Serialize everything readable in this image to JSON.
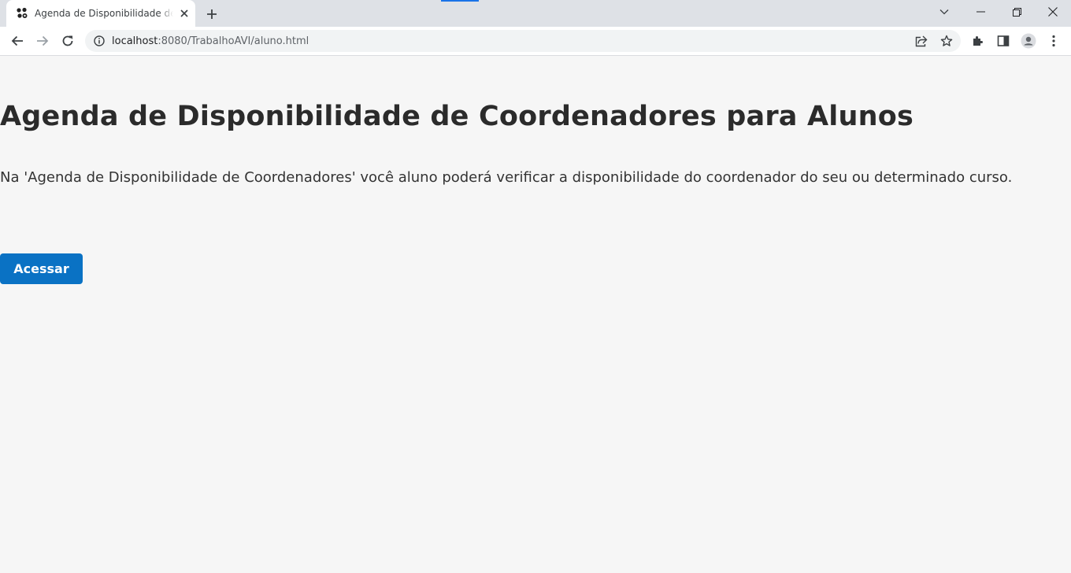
{
  "browser": {
    "tab": {
      "title": "Agenda de Disponibilidade de Coordenadores para Alunos"
    },
    "address": {
      "host": "localhost",
      "path": ":8080/TrabalhoAVI/aluno.html"
    },
    "colors": {
      "tab_accent": "#1a73e8",
      "chrome_bg": "#dee1e6",
      "omnibox_bg": "#f1f3f4"
    },
    "icons": [
      "favicon-icon",
      "close-icon",
      "plus-icon",
      "chevron-down-icon",
      "minimize-icon",
      "restore-icon",
      "window-close-icon",
      "back-arrow-icon",
      "forward-arrow-icon",
      "reload-icon",
      "info-icon",
      "share-icon",
      "star-icon",
      "extensions-icon",
      "side-panel-icon",
      "profile-icon",
      "menu-icon"
    ]
  },
  "page": {
    "title": "Agenda de Disponibilidade de Coordenadores para Alunos",
    "description": "Na 'Agenda de Disponibilidade de Coordenadores' você aluno poderá verificar a disponibilidade do coordenador do seu ou determinado curso.",
    "cta_label": "Acessar",
    "colors": {
      "background": "#f6f6f6",
      "cta": "#0a72c4",
      "text": "#2b2b2b"
    }
  }
}
